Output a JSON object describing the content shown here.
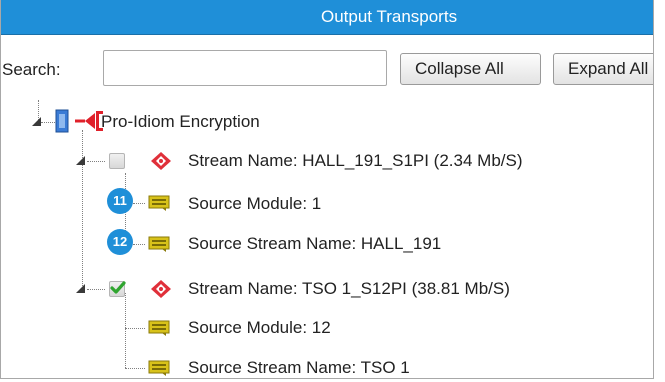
{
  "panel": {
    "title": "Output Transports"
  },
  "search": {
    "label": "Search:",
    "value": "",
    "placeholder": ""
  },
  "toolbar": {
    "collapse_label": "Collapse All",
    "expand_label": "Expand All"
  },
  "tree": {
    "root": {
      "label": "Pro-Idiom Encryption"
    },
    "streams": [
      {
        "label": "Stream Name: HALL_191_S1PI (2.34 Mb/S)",
        "checked": false,
        "children": [
          {
            "label": "Source Module: 1",
            "badge": "11"
          },
          {
            "label": "Source Stream Name: HALL_191",
            "badge": "12"
          }
        ]
      },
      {
        "label": "Stream Name: TSO 1_S12PI (38.81 Mb/S)",
        "checked": true,
        "children": [
          {
            "label": "Source Module: 12",
            "badge": ""
          },
          {
            "label": "Source Stream Name: TSO 1",
            "badge": ""
          }
        ]
      }
    ]
  },
  "colors": {
    "header_bg": "#1f8fd8",
    "badge_bg": "#1f8fd8",
    "check_green": "#2fa52f",
    "stream_icon_red": "#e0303a",
    "source_icon_yellow": "#d8c21a"
  }
}
